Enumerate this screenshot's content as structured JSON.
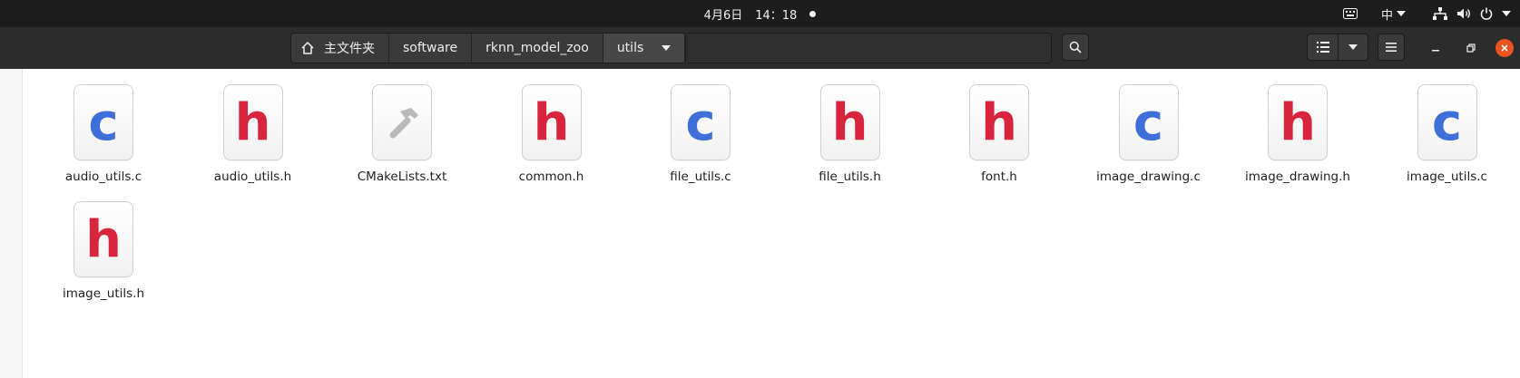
{
  "topbar": {
    "date": "4月6日",
    "time": "14：18",
    "input_method": "中",
    "indicators": [
      "keyboard-icon",
      "network-icon",
      "volume-icon",
      "power-icon"
    ]
  },
  "pathbar": {
    "home_label": "主文件夹",
    "crumbs": [
      "software",
      "rknn_model_zoo",
      "utils"
    ]
  },
  "colors": {
    "accent_close": "#e95420",
    "c_file": "#3e6ed8",
    "h_file": "#d8243d"
  },
  "files": [
    {
      "name": "audio_utils.c",
      "type": "c",
      "glyph": "c"
    },
    {
      "name": "audio_utils.h",
      "type": "h",
      "glyph": "h"
    },
    {
      "name": "CMakeLists.txt",
      "type": "build",
      "glyph": "hammer-icon"
    },
    {
      "name": "common.h",
      "type": "h",
      "glyph": "h"
    },
    {
      "name": "file_utils.c",
      "type": "c",
      "glyph": "c"
    },
    {
      "name": "file_utils.h",
      "type": "h",
      "glyph": "h"
    },
    {
      "name": "font.h",
      "type": "h",
      "glyph": "h"
    },
    {
      "name": "image_drawing.c",
      "type": "c",
      "glyph": "c"
    },
    {
      "name": "image_drawing.h",
      "type": "h",
      "glyph": "h"
    },
    {
      "name": "image_utils.c",
      "type": "c",
      "glyph": "c"
    },
    {
      "name": "image_utils.h",
      "type": "h",
      "glyph": "h"
    }
  ]
}
